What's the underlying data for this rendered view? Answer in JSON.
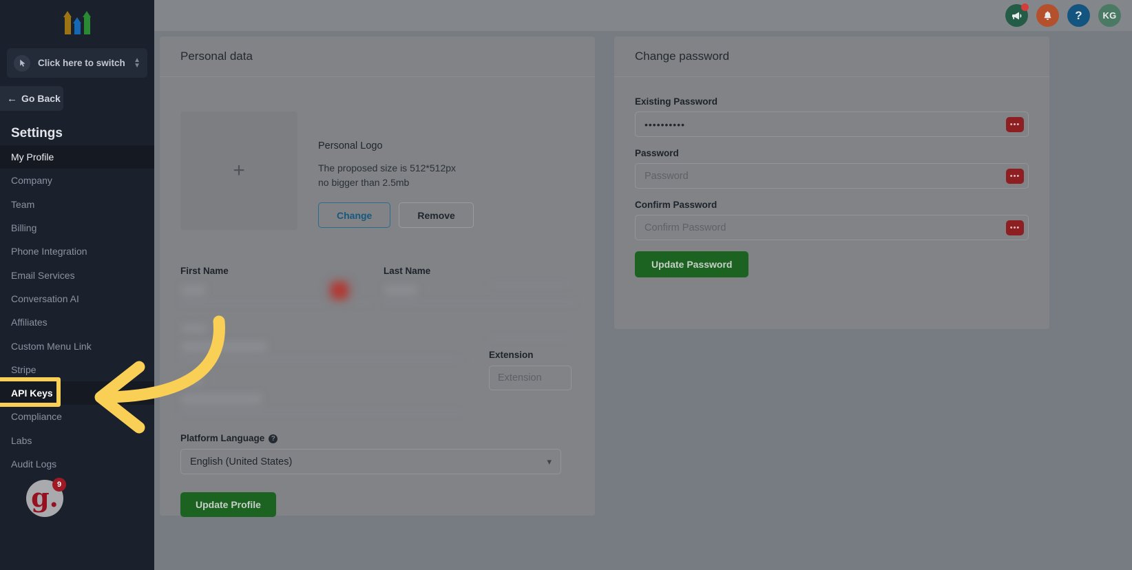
{
  "sidebar": {
    "logo_name": "three-arrows-logo",
    "switcher": {
      "label": "Click here to switch",
      "icon": "cursor-click-icon"
    },
    "go_back": {
      "label": "Go Back",
      "icon": "arrow-left-icon"
    },
    "section_title": "Settings",
    "items": [
      {
        "label": "My Profile",
        "state": "active"
      },
      {
        "label": "Company",
        "state": "normal"
      },
      {
        "label": "Team",
        "state": "normal"
      },
      {
        "label": "Billing",
        "state": "normal"
      },
      {
        "label": "Phone Integration",
        "state": "normal"
      },
      {
        "label": "Email Services",
        "state": "normal"
      },
      {
        "label": "Conversation AI",
        "state": "normal"
      },
      {
        "label": "Affiliates",
        "state": "normal"
      },
      {
        "label": "Custom Menu Link",
        "state": "normal"
      },
      {
        "label": "Stripe",
        "state": "normal"
      },
      {
        "label": "API Keys",
        "state": "highlighted"
      },
      {
        "label": "Compliance",
        "state": "normal"
      },
      {
        "label": "Labs",
        "state": "normal"
      },
      {
        "label": "Audit Logs",
        "state": "normal"
      }
    ],
    "avatar": {
      "glyph": "g.",
      "badge": "9"
    }
  },
  "header": {
    "buttons": [
      {
        "name": "megaphone-icon",
        "glyph": "📢",
        "color": "#245c47",
        "badge": true
      },
      {
        "name": "bell-icon",
        "glyph": "🔔",
        "color": "#b4502b",
        "badge": false
      },
      {
        "name": "help-icon",
        "glyph": "?",
        "color": "#14557f",
        "badge": false
      },
      {
        "name": "user-avatar",
        "glyph": "KG",
        "color": "#4a7a63",
        "badge": false
      }
    ]
  },
  "personal_data": {
    "card_title": "Personal data",
    "logo": {
      "title": "Personal Logo",
      "hint_line1": "The proposed size is 512*512px",
      "hint_line2": "no bigger than 2.5mb",
      "change_label": "Change",
      "remove_label": "Remove",
      "placeholder_glyph": "+"
    },
    "first_name_label": "First Name",
    "last_name_label": "Last Name",
    "extension_label": "Extension",
    "extension_placeholder": "Extension",
    "platform_language_label": "Platform Language",
    "platform_language_value": "English (United States)",
    "update_profile_label": "Update Profile"
  },
  "change_password": {
    "card_title": "Change password",
    "fields": [
      {
        "label": "Existing Password",
        "value": "••••••••••",
        "placeholder": "",
        "filled": true
      },
      {
        "label": "Password",
        "value": "",
        "placeholder": "Password",
        "filled": false
      },
      {
        "label": "Confirm Password",
        "value": "",
        "placeholder": "Confirm Password",
        "filled": false
      }
    ],
    "toggle_glyph": "•••",
    "update_label": "Update Password"
  },
  "annotation": {
    "arrow_color": "#f9cf56",
    "highlight_color": "#f9cf56",
    "highlight_target": "API Keys"
  },
  "colors": {
    "sidebar_bg": "#1b212c",
    "overlay_bg": "#767c81",
    "card_bg": "#818387",
    "green_button": "#1c6321",
    "accent_yellow": "#f9cf56"
  }
}
